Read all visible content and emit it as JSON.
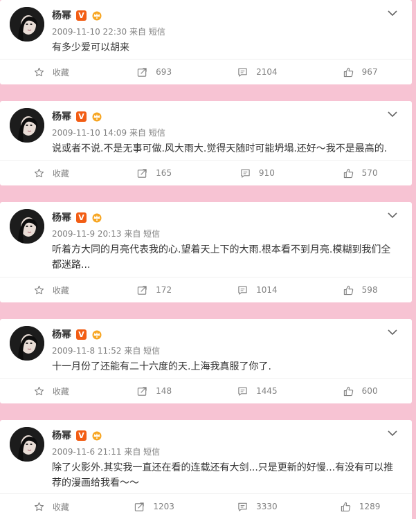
{
  "posts": [
    {
      "name": "杨幂",
      "vip": "V",
      "time": "2009-11-10 22:30",
      "source_prefix": "来自",
      "source": "短信",
      "lines": [
        "有多少爱可以胡来"
      ],
      "collect": "收藏",
      "forward": "693",
      "comment": "2104",
      "like": "967"
    },
    {
      "name": "杨幂",
      "vip": "V",
      "time": "2009-11-10 14:09",
      "source_prefix": "来自",
      "source": "短信",
      "lines": [
        "说或者不说.不是无事可做.风大雨大.觉得天随时可能坍塌.还好～我不是最高的."
      ],
      "collect": "收藏",
      "forward": "165",
      "comment": "910",
      "like": "570"
    },
    {
      "name": "杨幂",
      "vip": "V",
      "time": "2009-11-9 20:13",
      "source_prefix": "来自",
      "source": "短信",
      "lines": [
        "听着方大同的月亮代表我的心.望着天上下的大雨.根本看不到月亮.模糊到我们全",
        "都迷路..."
      ],
      "collect": "收藏",
      "forward": "172",
      "comment": "1014",
      "like": "598"
    },
    {
      "name": "杨幂",
      "vip": "V",
      "time": "2009-11-8 11:52",
      "source_prefix": "来自",
      "source": "短信",
      "lines": [
        "十一月份了还能有二十六度的天.上海我真服了你了."
      ],
      "collect": "收藏",
      "forward": "148",
      "comment": "1445",
      "like": "600"
    },
    {
      "name": "杨幂",
      "vip": "V",
      "time": "2009-11-6 21:11",
      "source_prefix": "来自",
      "source": "短信",
      "lines": [
        "除了火影外.其实我一直还在看的连载还有大剑...只是更新的好慢...有没有可以推",
        "荐的漫画给我看～～"
      ],
      "collect": "收藏",
      "forward": "1203",
      "comment": "3330",
      "like": "1289"
    }
  ],
  "colors": {
    "background": "#f7c3d3",
    "card": "#ffffff",
    "vip_badge": "#f25d14",
    "crown": "#f7a623",
    "meta": "#808080"
  }
}
